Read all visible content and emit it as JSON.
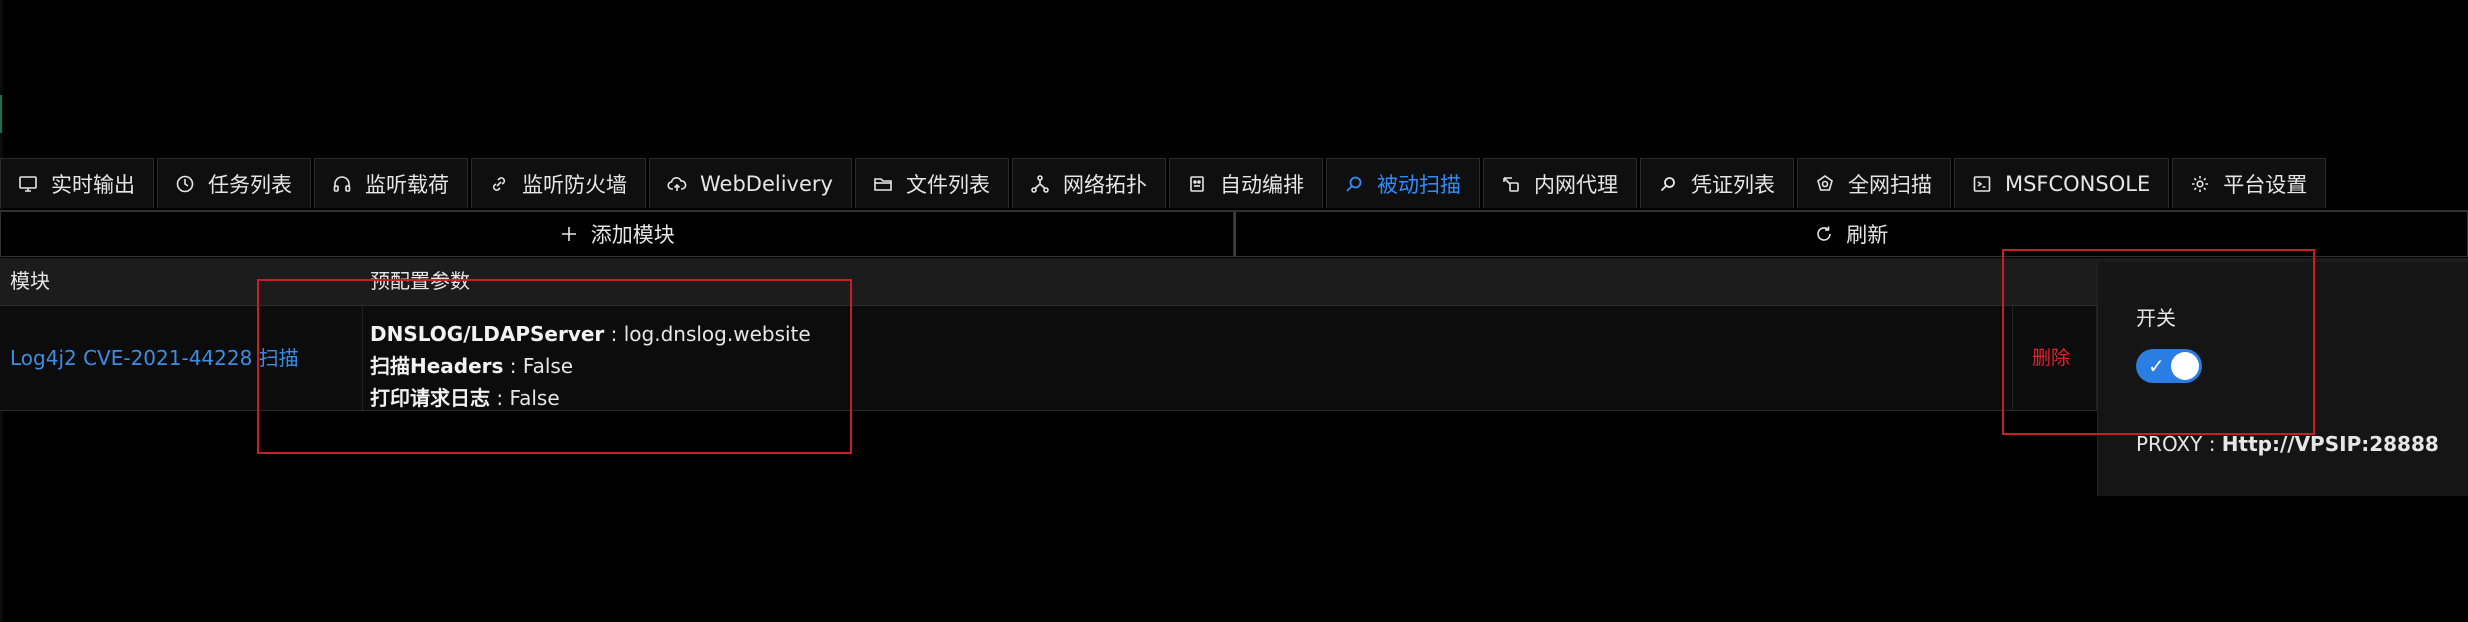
{
  "tabs": [
    {
      "label": "实时输出",
      "icon": "monitor-icon"
    },
    {
      "label": "任务列表",
      "icon": "clock-icon"
    },
    {
      "label": "监听载荷",
      "icon": "headphones-icon"
    },
    {
      "label": "监听防火墙",
      "icon": "link-icon"
    },
    {
      "label": "WebDelivery",
      "icon": "cloud-upload-icon"
    },
    {
      "label": "文件列表",
      "icon": "folder-icon"
    },
    {
      "label": "网络拓扑",
      "icon": "topology-icon"
    },
    {
      "label": "自动编排",
      "icon": "robot-icon"
    },
    {
      "label": "被动扫描",
      "icon": "search-icon",
      "active": true
    },
    {
      "label": "内网代理",
      "icon": "proxy-icon"
    },
    {
      "label": "凭证列表",
      "icon": "key-search-icon"
    },
    {
      "label": "全网扫描",
      "icon": "globe-icon"
    },
    {
      "label": "MSFCONSOLE",
      "icon": "terminal-icon"
    },
    {
      "label": "平台设置",
      "icon": "gear-icon"
    }
  ],
  "toolbar": {
    "add_label": "添加模块",
    "refresh_label": "刷新"
  },
  "table": {
    "headers": {
      "module": "模块",
      "params": "预配置参数"
    },
    "rows": [
      {
        "module": "Log4j2 CVE-2021-44228 扫描",
        "params": [
          {
            "key": "DNSLOG/LDAPServer",
            "value": " : log.dnslog.website"
          },
          {
            "key": "扫描Headers",
            "value": " : False"
          },
          {
            "key": "打印请求日志",
            "value": " : False"
          }
        ],
        "action": "删除"
      }
    ]
  },
  "popover": {
    "switch_label": "开关",
    "switch_on": true,
    "proxy_key": "PROXY : ",
    "proxy_value": "Http://VPSIP:28888"
  },
  "colors": {
    "accent": "#2f8cff",
    "danger": "#e0242f",
    "annotation": "#c81e28"
  }
}
